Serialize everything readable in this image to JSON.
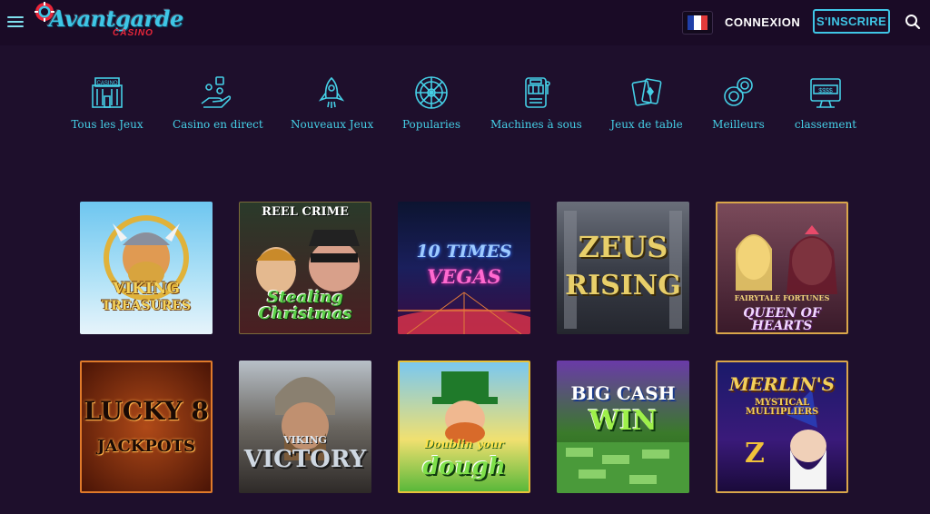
{
  "header": {
    "logo_main": "Avantgarde",
    "logo_sub": "CASINO",
    "login_label": "CONNEXION",
    "signup_label": "S'INSCRIRE"
  },
  "categories": [
    {
      "label": "Tous les Jeux",
      "icon": "casino-building-icon"
    },
    {
      "label": "Casino en direct",
      "icon": "dealer-hand-icon"
    },
    {
      "label": "Nouveaux Jeux",
      "icon": "new-rocket-icon"
    },
    {
      "label": "Popularies",
      "icon": "roulette-icon"
    },
    {
      "label": "Machines à sous",
      "icon": "slot-machine-icon"
    },
    {
      "label": "Jeux de table",
      "icon": "playing-cards-icon"
    },
    {
      "label": "Meilleurs",
      "icon": "chips-icon"
    },
    {
      "label": "classement",
      "icon": "jackpot-screen-icon"
    }
  ],
  "games": [
    {
      "l1": "VIKING",
      "l2": "TREASURES"
    },
    {
      "l1": "REEL CRIME",
      "l2": "Stealing Christmas"
    },
    {
      "l1": "10 TIMES",
      "l2": "VEGAS"
    },
    {
      "l1": "ZEUS",
      "l2": "RISING"
    },
    {
      "l1": "FAIRYTALE FORTUNES",
      "l2": "QUEEN OF HEARTS"
    },
    {
      "l1": "LUCKY 8",
      "l2": "JACKPOTS"
    },
    {
      "l1": "VIKING",
      "l2": "VICTORY"
    },
    {
      "l1": "Doublin your",
      "l2": "dough"
    },
    {
      "l1": "BIG CASH",
      "l2": "WIN"
    },
    {
      "l1": "MERLIN'S",
      "l2": "MYSTICAL MULTIPLIERS"
    }
  ],
  "colors": {
    "accent": "#3fc6e6",
    "background": "#1e0f2c",
    "logo_red": "#e8263a"
  }
}
